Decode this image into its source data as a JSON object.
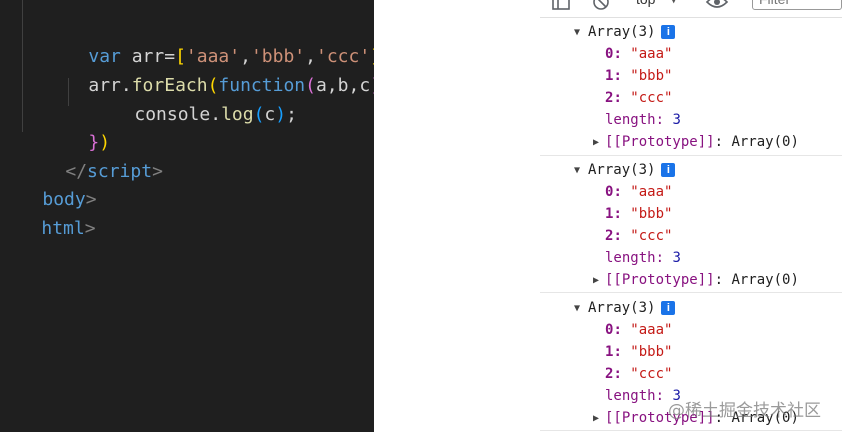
{
  "editor": {
    "line1": {
      "kw": "var",
      "text": "arr=",
      "open": "[",
      "s1": "'aaa'",
      "c1": ",",
      "s2": "'bbb'",
      "c2": ",",
      "s3": "'ccc'",
      "close": "]"
    },
    "line2": {
      "obj": "arr.",
      "method": "forEach",
      "open": "(",
      "fn": "function",
      "params_open": "(",
      "params": "a,b,c",
      "params_close": ")",
      "brace": "{"
    },
    "line3": {
      "obj": "console.",
      "method": "log",
      "open": "(",
      "arg": "c",
      "close": ")",
      "semi": ";"
    },
    "line4": {
      "brace": "}",
      "paren": ")"
    },
    "line5": {
      "lt": "</",
      "tag": "script",
      "gt": ">"
    },
    "line6": {
      "tag": "body",
      "gt": ">"
    },
    "line7": {
      "tag": "html",
      "gt": ">"
    }
  },
  "console": {
    "toolbar": {
      "context": "top",
      "filter_placeholder": "Filter"
    },
    "groups": [
      {
        "header": "Array(3)",
        "info": "i",
        "items": [
          {
            "key": "0",
            "value": "\"aaa\""
          },
          {
            "key": "1",
            "value": "\"bbb\""
          },
          {
            "key": "2",
            "value": "\"ccc\""
          }
        ],
        "length_key": "length",
        "length_value": "3",
        "prototype_label": "[[Prototype]]",
        "prototype_value": "Array(0)"
      },
      {
        "header": "Array(3)",
        "info": "i",
        "items": [
          {
            "key": "0",
            "value": "\"aaa\""
          },
          {
            "key": "1",
            "value": "\"bbb\""
          },
          {
            "key": "2",
            "value": "\"ccc\""
          }
        ],
        "length_key": "length",
        "length_value": "3",
        "prototype_label": "[[Prototype]]",
        "prototype_value": "Array(0)"
      },
      {
        "header": "Array(3)",
        "info": "i",
        "items": [
          {
            "key": "0",
            "value": "\"aaa\""
          },
          {
            "key": "1",
            "value": "\"bbb\""
          },
          {
            "key": "2",
            "value": "\"ccc\""
          }
        ],
        "length_key": "length",
        "length_value": "3",
        "prototype_label": "[[Prototype]]",
        "prototype_value": "Array(0)"
      }
    ]
  },
  "watermark": "@稀土掘金技术社区"
}
